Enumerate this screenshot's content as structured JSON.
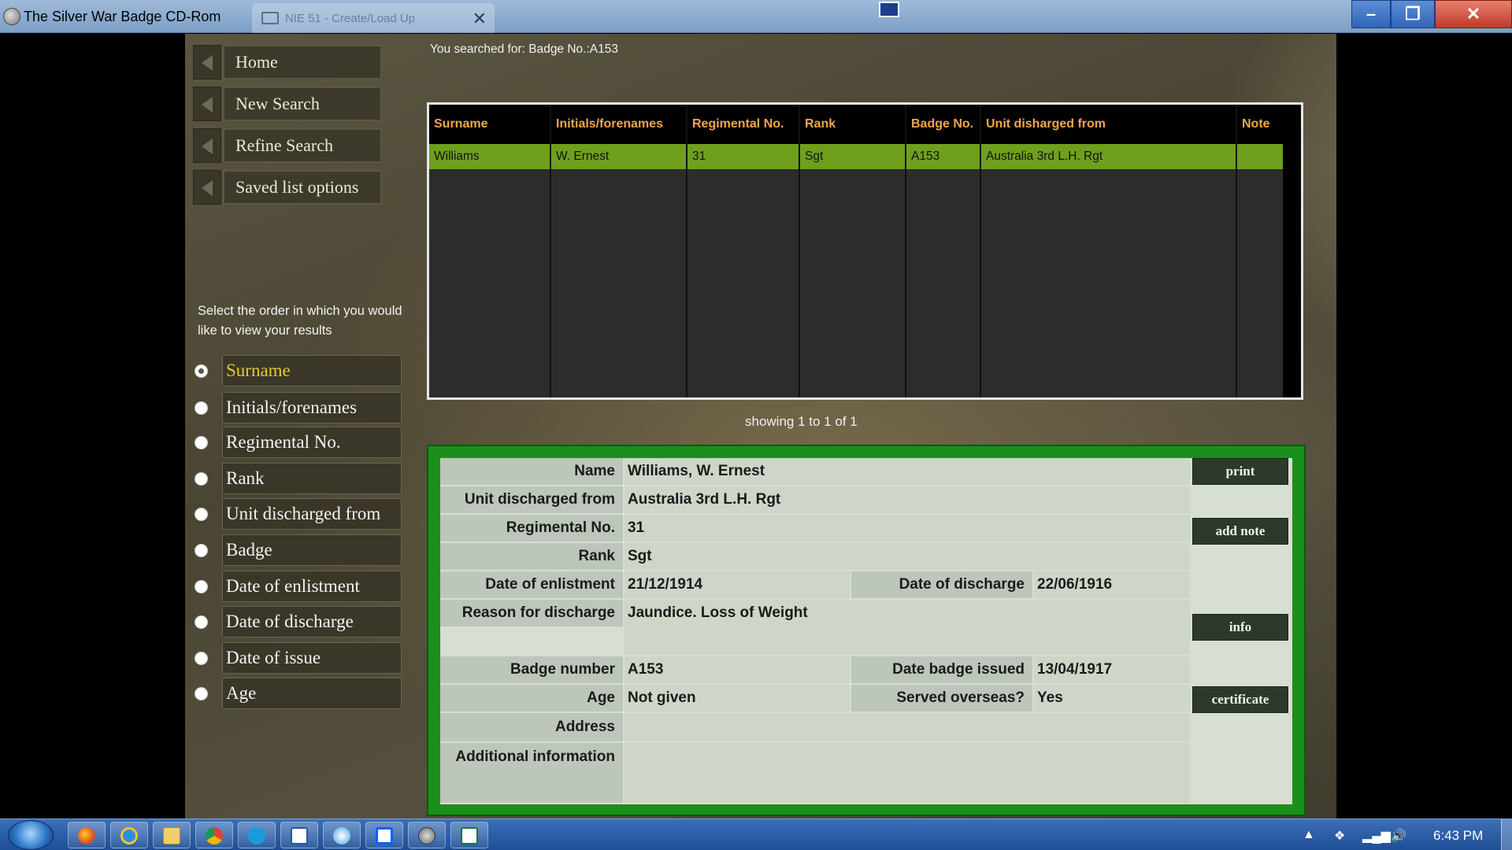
{
  "window": {
    "title": "The Silver War Badge CD-Rom",
    "background_tab": "NIE 51 - Create/Load Up"
  },
  "nav": {
    "items": [
      "Home",
      "New Search",
      "Refine Search",
      "Saved list options"
    ]
  },
  "sort": {
    "prompt": "Select the order in which you would like to view your results",
    "selected": "Surname",
    "options": [
      "Surname",
      "Initials/forenames",
      "Regimental No.",
      "Rank",
      "Unit discharged from",
      "Badge",
      "Date of enlistment",
      "Date of discharge",
      "Date of issue",
      "Age"
    ]
  },
  "search": {
    "summary": "You searched for:  Badge No.:A153"
  },
  "results": {
    "columns": [
      "Surname",
      "Initials/forenames",
      "Regimental No.",
      "Rank",
      "Badge No.",
      "Unit disharged from",
      "Note"
    ],
    "rows": [
      [
        "Williams",
        "W. Ernest",
        "31",
        "Sgt",
        "A153",
        "Australia 3rd L.H. Rgt",
        ""
      ]
    ],
    "showing": "showing 1 to 1 of 1",
    "selected_row_color": "#6ea01e",
    "header_text_color": "#f0a64a"
  },
  "detail": {
    "name_label": "Name",
    "name": "Williams, W. Ernest",
    "unit_label": "Unit discharged from",
    "unit": "Australia 3rd L.H. Rgt",
    "regno_label": "Regimental No.",
    "regno": "31",
    "rank_label": "Rank",
    "rank": "Sgt",
    "enlist_label": "Date of enlistment",
    "enlist": "21/12/1914",
    "discharge_label": "Date of discharge",
    "discharge": "22/06/1916",
    "reason_label": "Reason for discharge",
    "reason": "Jaundice. Loss of Weight",
    "badge_label": "Badge number",
    "badge": "A153",
    "issued_label": "Date badge issued",
    "issued": "13/04/1917",
    "age_label": "Age",
    "age": "Not given",
    "overseas_label": "Served overseas?",
    "overseas": "Yes",
    "address_label": "Address",
    "address": "",
    "additional_label": "Additional information",
    "additional": "",
    "buttons": {
      "print": "print",
      "add_note": "add note",
      "info": "info",
      "certificate": "certificate"
    },
    "frame_color": "#1b8f1b"
  },
  "taskbar": {
    "icons": [
      "windows-start",
      "firefox",
      "internet-explorer",
      "file-explorer",
      "chrome",
      "skype",
      "word",
      "media",
      "dropbox",
      "silver-war-badge",
      "excel"
    ],
    "clock": "6:43 PM"
  }
}
